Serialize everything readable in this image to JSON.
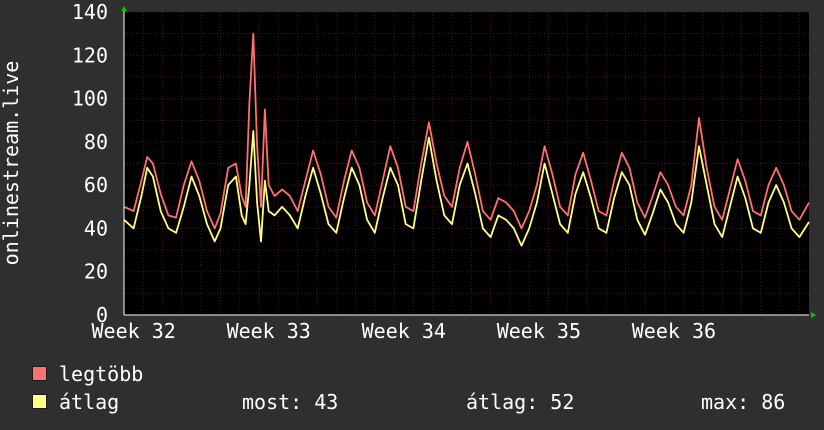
{
  "chart_data": {
    "type": "line",
    "ylabel": "onlinestream.live",
    "ylim": [
      0,
      140
    ],
    "y_ticks": [
      "0",
      "20",
      "40",
      "60",
      "80",
      "100",
      "120",
      "140"
    ],
    "x_ticks": [
      "Week 32",
      "Week 33",
      "Week 34",
      "Week 35",
      "Week 36"
    ],
    "x_unit": "day",
    "x_range": [
      0,
      35.5
    ],
    "grid": true,
    "colors": {
      "background": "#2f2f2f",
      "plot_bg": "#000000",
      "grid": "#4a1818",
      "axis": "#ffffff",
      "arrow": "#00cc00"
    },
    "series": [
      {
        "name": "legtöbb",
        "color": "#ff7070",
        "values": [
          [
            0.0,
            50
          ],
          [
            0.5,
            48
          ],
          [
            0.9,
            62
          ],
          [
            1.2,
            73
          ],
          [
            1.5,
            70
          ],
          [
            1.9,
            56
          ],
          [
            2.3,
            46
          ],
          [
            2.7,
            45
          ],
          [
            3.1,
            60
          ],
          [
            3.5,
            71
          ],
          [
            3.9,
            62
          ],
          [
            4.3,
            48
          ],
          [
            4.7,
            40
          ],
          [
            5.0,
            47
          ],
          [
            5.4,
            68
          ],
          [
            5.8,
            70
          ],
          [
            6.1,
            55
          ],
          [
            6.3,
            50
          ],
          [
            6.5,
            98
          ],
          [
            6.7,
            130
          ],
          [
            6.9,
            78
          ],
          [
            7.1,
            50
          ],
          [
            7.3,
            95
          ],
          [
            7.5,
            60
          ],
          [
            7.8,
            55
          ],
          [
            8.2,
            58
          ],
          [
            8.6,
            55
          ],
          [
            9.0,
            48
          ],
          [
            9.4,
            62
          ],
          [
            9.8,
            76
          ],
          [
            10.2,
            65
          ],
          [
            10.6,
            50
          ],
          [
            11.0,
            45
          ],
          [
            11.4,
            62
          ],
          [
            11.8,
            76
          ],
          [
            12.2,
            68
          ],
          [
            12.6,
            52
          ],
          [
            13.0,
            46
          ],
          [
            13.4,
            62
          ],
          [
            13.8,
            78
          ],
          [
            14.2,
            68
          ],
          [
            14.6,
            50
          ],
          [
            15.0,
            48
          ],
          [
            15.4,
            70
          ],
          [
            15.8,
            89
          ],
          [
            16.2,
            70
          ],
          [
            16.6,
            55
          ],
          [
            17.0,
            50
          ],
          [
            17.4,
            68
          ],
          [
            17.8,
            80
          ],
          [
            18.2,
            65
          ],
          [
            18.6,
            48
          ],
          [
            19.0,
            44
          ],
          [
            19.4,
            54
          ],
          [
            19.8,
            52
          ],
          [
            20.2,
            48
          ],
          [
            20.6,
            40
          ],
          [
            21.0,
            48
          ],
          [
            21.4,
            60
          ],
          [
            21.8,
            78
          ],
          [
            22.2,
            65
          ],
          [
            22.6,
            50
          ],
          [
            23.0,
            46
          ],
          [
            23.4,
            65
          ],
          [
            23.8,
            75
          ],
          [
            24.2,
            62
          ],
          [
            24.6,
            48
          ],
          [
            25.0,
            46
          ],
          [
            25.4,
            62
          ],
          [
            25.8,
            75
          ],
          [
            26.2,
            68
          ],
          [
            26.6,
            52
          ],
          [
            27.0,
            45
          ],
          [
            27.4,
            55
          ],
          [
            27.8,
            66
          ],
          [
            28.2,
            60
          ],
          [
            28.6,
            50
          ],
          [
            29.0,
            46
          ],
          [
            29.4,
            60
          ],
          [
            29.8,
            91
          ],
          [
            30.2,
            68
          ],
          [
            30.6,
            50
          ],
          [
            31.0,
            44
          ],
          [
            31.4,
            58
          ],
          [
            31.8,
            72
          ],
          [
            32.2,
            62
          ],
          [
            32.6,
            48
          ],
          [
            33.0,
            46
          ],
          [
            33.4,
            60
          ],
          [
            33.8,
            68
          ],
          [
            34.2,
            60
          ],
          [
            34.6,
            48
          ],
          [
            35.0,
            44
          ],
          [
            35.5,
            52
          ]
        ]
      },
      {
        "name": "átlag",
        "color": "#ffff80",
        "values": [
          [
            0.0,
            44
          ],
          [
            0.5,
            40
          ],
          [
            0.9,
            55
          ],
          [
            1.2,
            68
          ],
          [
            1.5,
            64
          ],
          [
            1.9,
            48
          ],
          [
            2.3,
            40
          ],
          [
            2.7,
            38
          ],
          [
            3.1,
            50
          ],
          [
            3.5,
            64
          ],
          [
            3.9,
            55
          ],
          [
            4.3,
            42
          ],
          [
            4.7,
            34
          ],
          [
            5.0,
            40
          ],
          [
            5.4,
            60
          ],
          [
            5.8,
            64
          ],
          [
            6.1,
            46
          ],
          [
            6.3,
            42
          ],
          [
            6.5,
            60
          ],
          [
            6.7,
            85
          ],
          [
            6.9,
            52
          ],
          [
            7.1,
            34
          ],
          [
            7.3,
            62
          ],
          [
            7.5,
            48
          ],
          [
            7.8,
            46
          ],
          [
            8.2,
            50
          ],
          [
            8.6,
            46
          ],
          [
            9.0,
            40
          ],
          [
            9.4,
            55
          ],
          [
            9.8,
            68
          ],
          [
            10.2,
            56
          ],
          [
            10.6,
            42
          ],
          [
            11.0,
            38
          ],
          [
            11.4,
            54
          ],
          [
            11.8,
            68
          ],
          [
            12.2,
            60
          ],
          [
            12.6,
            44
          ],
          [
            13.0,
            38
          ],
          [
            13.4,
            54
          ],
          [
            13.8,
            68
          ],
          [
            14.2,
            60
          ],
          [
            14.6,
            42
          ],
          [
            15.0,
            40
          ],
          [
            15.4,
            62
          ],
          [
            15.8,
            82
          ],
          [
            16.2,
            62
          ],
          [
            16.6,
            46
          ],
          [
            17.0,
            42
          ],
          [
            17.4,
            60
          ],
          [
            17.8,
            70
          ],
          [
            18.2,
            56
          ],
          [
            18.6,
            40
          ],
          [
            19.0,
            36
          ],
          [
            19.4,
            46
          ],
          [
            19.8,
            44
          ],
          [
            20.2,
            40
          ],
          [
            20.6,
            32
          ],
          [
            21.0,
            40
          ],
          [
            21.4,
            52
          ],
          [
            21.8,
            70
          ],
          [
            22.2,
            56
          ],
          [
            22.6,
            42
          ],
          [
            23.0,
            38
          ],
          [
            23.4,
            56
          ],
          [
            23.8,
            66
          ],
          [
            24.2,
            54
          ],
          [
            24.6,
            40
          ],
          [
            25.0,
            38
          ],
          [
            25.4,
            54
          ],
          [
            25.8,
            66
          ],
          [
            26.2,
            60
          ],
          [
            26.6,
            44
          ],
          [
            27.0,
            37
          ],
          [
            27.4,
            47
          ],
          [
            27.8,
            58
          ],
          [
            28.2,
            52
          ],
          [
            28.6,
            42
          ],
          [
            29.0,
            38
          ],
          [
            29.4,
            52
          ],
          [
            29.8,
            78
          ],
          [
            30.2,
            60
          ],
          [
            30.6,
            42
          ],
          [
            31.0,
            36
          ],
          [
            31.4,
            50
          ],
          [
            31.8,
            64
          ],
          [
            32.2,
            54
          ],
          [
            32.6,
            40
          ],
          [
            33.0,
            38
          ],
          [
            33.4,
            52
          ],
          [
            33.8,
            60
          ],
          [
            34.2,
            52
          ],
          [
            34.6,
            40
          ],
          [
            35.0,
            36
          ],
          [
            35.5,
            43
          ]
        ]
      }
    ]
  },
  "legend": {
    "items": [
      {
        "label": "legtöbb",
        "color": "#ff7070"
      },
      {
        "label": "átlag",
        "color": "#ffff80"
      }
    ],
    "stats": {
      "most": "most: 43",
      "atlag": "átlag: 52",
      "max": "max: 86"
    }
  }
}
